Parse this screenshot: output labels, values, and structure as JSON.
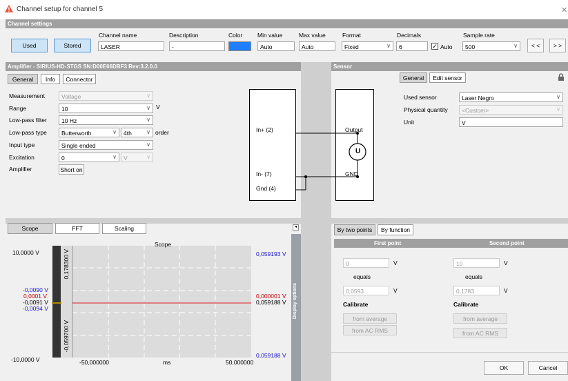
{
  "window": {
    "title": "Channel setup for channel 5"
  },
  "channel_settings": {
    "header": "Channel settings",
    "used_label": "Used",
    "stored_label": "Stored",
    "channel_name_label": "Channel name",
    "channel_name_value": "LASER",
    "description_label": "Description",
    "description_value": "-",
    "color_label": "Color",
    "color_value": "#1f7fff",
    "min_label": "Min value",
    "min_value": "Auto",
    "max_label": "Max value",
    "max_value": "Auto",
    "format_label": "Format",
    "format_value": "Fixed",
    "decimals_label": "Decimals",
    "decimals_value": "6",
    "auto_label": "Auto",
    "auto_checked": true,
    "sample_rate_label": "Sample rate",
    "sample_rate_value": "500",
    "prev_label": "< <",
    "next_label": "> >"
  },
  "amplifier": {
    "header": "Amplifier - SIRIUS-HD-STGS  SN:D00E66DBF3 Rev:3.2.0.0",
    "tabs": [
      "General",
      "Info",
      "Connector"
    ],
    "measurement_label": "Measurement",
    "measurement_value": "Voltage",
    "range_label": "Range",
    "range_value": "10",
    "range_unit": "V",
    "lowpass_filter_label": "Low-pass filter",
    "lowpass_filter_value": "10 Hz",
    "lowpass_type_label": "Low-pass type",
    "lowpass_type_value": "Butterworth",
    "order_value": "4th",
    "order_label": "order",
    "input_type_label": "Input type",
    "input_type_value": "Single ended",
    "excitation_label": "Excitation",
    "excitation_value": "0",
    "excitation_unit": "V",
    "amplifier_label": "Amplifier",
    "short_on_label": "Short on"
  },
  "diagram": {
    "in_plus": "In+ (2)",
    "in_minus": "In- (7)",
    "gnd": "Gnd (4)",
    "output": "Output",
    "gnd_right": "GND",
    "u": "U"
  },
  "sensor": {
    "header": "Sensor",
    "tabs": [
      "General",
      "Edit sensor"
    ],
    "used_sensor_label": "Used sensor",
    "used_sensor_value": "Laser Negro",
    "physical_quantity_label": "Physical quantity",
    "physical_quantity_value": "<Custom>",
    "unit_label": "Unit",
    "unit_value": "V"
  },
  "scope_panel": {
    "tabs": [
      "Scope",
      "FFT",
      "Scaling"
    ],
    "title": "Scope",
    "y_top": "10,0000 V",
    "y_bottom": "-10,0000 V",
    "left_values_blue": [
      "-0,0090 V"
    ],
    "left_value_red": "0,0001 V",
    "left_value_black": "-0,0091 V",
    "left_value_blue2": "-0,0094 V",
    "inner_top": "0,178300 V",
    "inner_bottom": "-0,059700 V",
    "right_top": "0,059193 V",
    "right_red": "0,000001 V",
    "right_black": "0,059188 V",
    "right_bottom": "0,059188 V",
    "x_min": "-50,000000",
    "x_unit": "ms",
    "x_max": "50,000000",
    "display_options": "Display options"
  },
  "scaling": {
    "tabs": [
      "By two points",
      "By function"
    ],
    "first_point": "First point",
    "second_point": "Second point",
    "first_in": "0",
    "first_in_unit": "V",
    "equals": "equals",
    "first_out": "0,0593",
    "first_out_unit": "V",
    "second_in": "10",
    "second_in_unit": "V",
    "second_out": "0,1783",
    "second_out_unit": "V",
    "calibrate": "Calibrate",
    "from_average": "from average",
    "from_ac_rms": "from AC RMS"
  },
  "footer": {
    "ok": "OK",
    "cancel": "Cancel"
  },
  "chart_data": {
    "type": "line",
    "title": "Scope",
    "xlabel": "ms",
    "x": [
      -50,
      50
    ],
    "series": [
      {
        "values": [
          0.0001,
          0.0001
        ]
      }
    ],
    "xlim": [
      -50,
      50
    ]
  }
}
